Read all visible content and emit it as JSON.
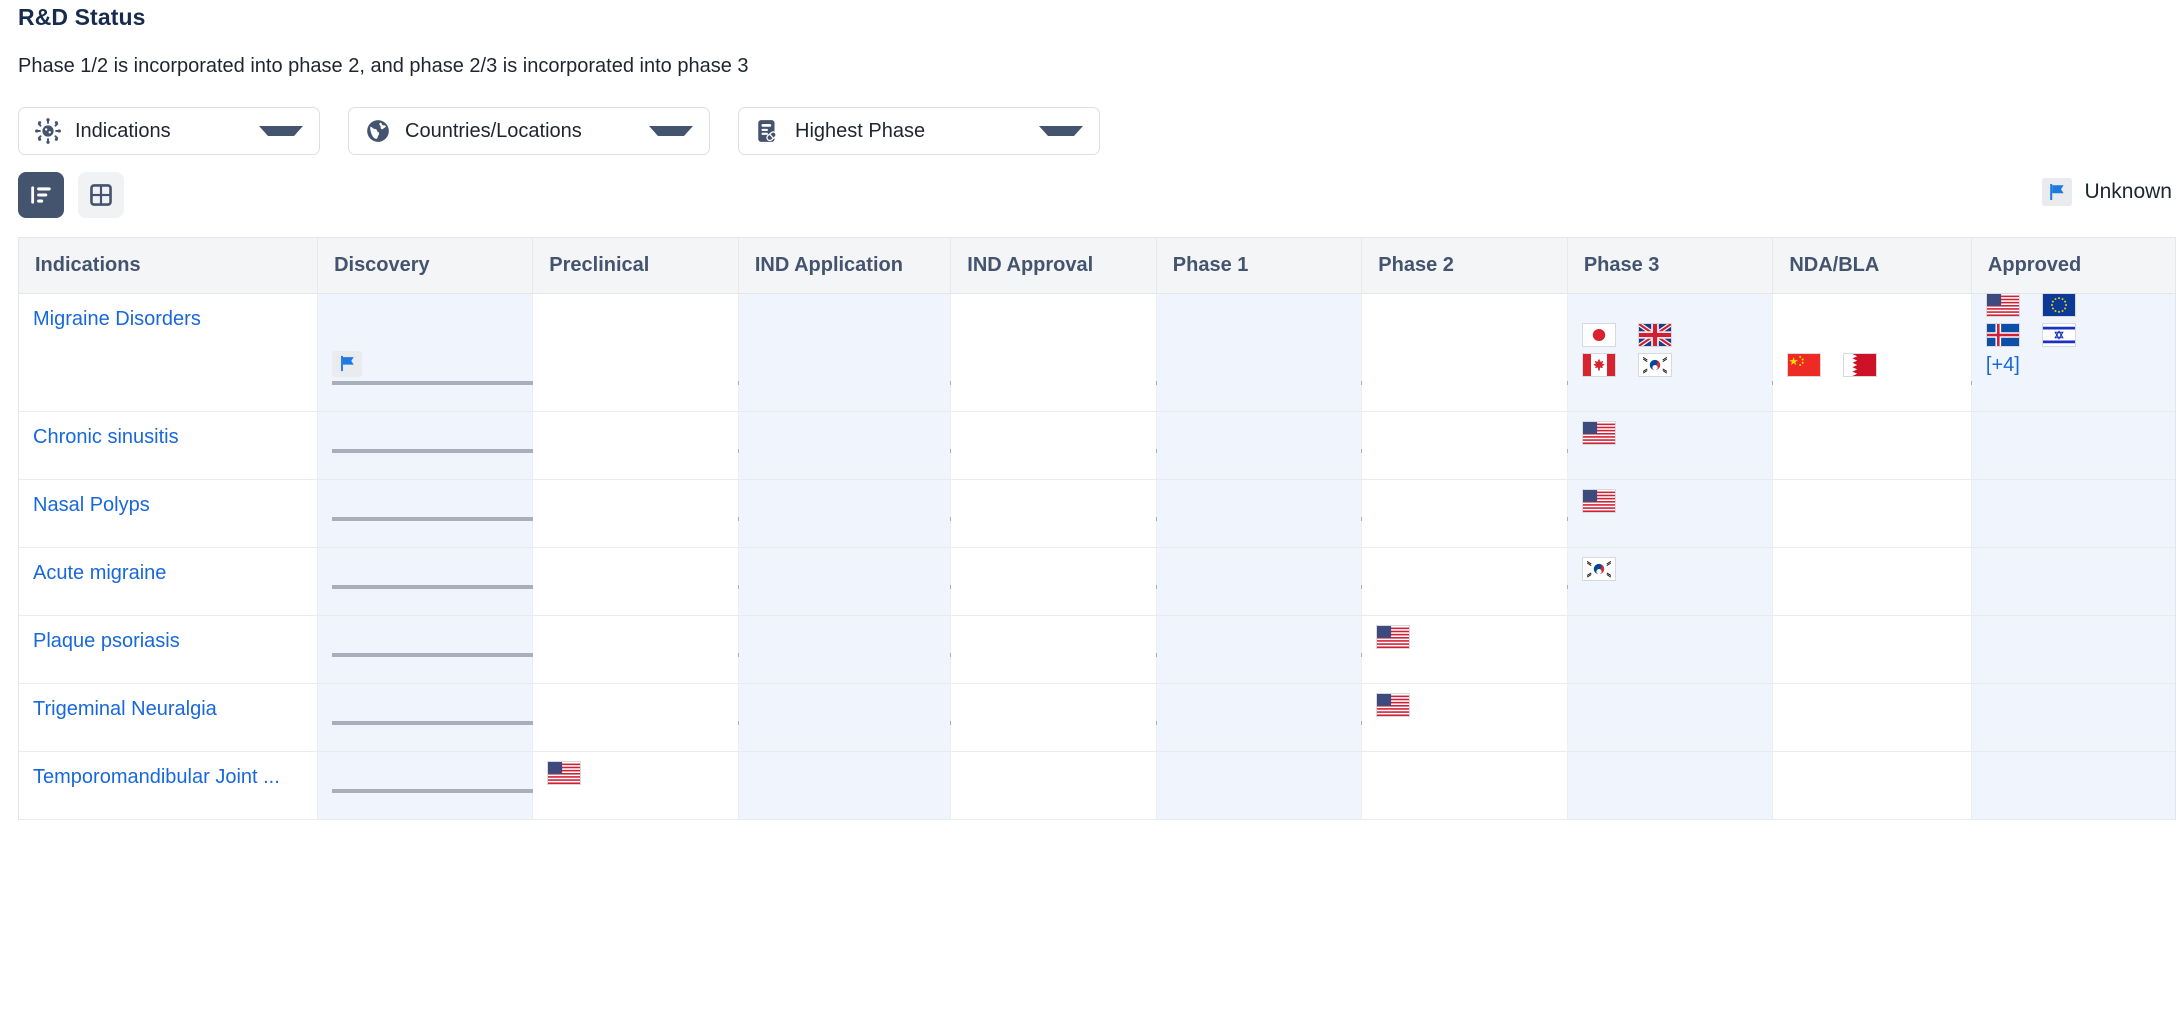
{
  "header": {
    "title": "R&D Status",
    "subtitle": "Phase 1/2 is incorporated into phase 2, and phase 2/3 is incorporated into phase 3"
  },
  "filters": [
    {
      "id": "indications",
      "label": "Indications",
      "icon": "virus-icon"
    },
    {
      "id": "countries",
      "label": "Countries/Locations",
      "icon": "globe-icon"
    },
    {
      "id": "phase",
      "label": "Highest Phase",
      "icon": "document-pill-icon"
    }
  ],
  "view_toggle": [
    {
      "id": "list-view",
      "icon": "list-view-icon",
      "active": true
    },
    {
      "id": "grid-view",
      "icon": "grid-view-icon",
      "active": false
    }
  ],
  "legend": {
    "icon": "flag-icon",
    "label": "Unknown"
  },
  "colors": {
    "link": "#1868db",
    "header_text": "#44546f",
    "header_bg": "#f4f5f7",
    "column_alt_bg": "#eff4fd",
    "arrow": "#a9aebb",
    "toggle_active_bg": "#44546f",
    "toggle_inactive_bg": "#f1f2f4",
    "flag_unknown_blue": "#1e7ae0"
  },
  "table": {
    "columns": [
      "Indications",
      "Discovery",
      "Preclinical",
      "IND Application",
      "IND Approval",
      "Phase 1",
      "Phase 2",
      "Phase 3",
      "NDA/BLA",
      "Approved"
    ],
    "rows": [
      {
        "indication": "Migraine Disorders",
        "arrow_from": "Discovery",
        "arrow_to": "Approved",
        "cells": {
          "Discovery": {
            "flags": [
              "unknown"
            ]
          },
          "Phase 3": {
            "flags": [
              "jp",
              "gb",
              "ca",
              "kr"
            ]
          },
          "NDA/BLA": {
            "flags": [
              "cn",
              "bh"
            ]
          },
          "Approved": {
            "flags": [
              "us",
              "eu",
              "is",
              "il"
            ],
            "more": "[+4]"
          }
        }
      },
      {
        "indication": "Chronic sinusitis",
        "arrow_from": "Discovery",
        "arrow_to": "Phase 3",
        "cells": {
          "Phase 3": {
            "flags": [
              "us"
            ]
          }
        }
      },
      {
        "indication": "Nasal Polyps",
        "arrow_from": "Discovery",
        "arrow_to": "Phase 3",
        "cells": {
          "Phase 3": {
            "flags": [
              "us"
            ]
          }
        }
      },
      {
        "indication": "Acute migraine",
        "arrow_from": "Discovery",
        "arrow_to": "Phase 3",
        "cells": {
          "Phase 3": {
            "flags": [
              "kr"
            ]
          }
        }
      },
      {
        "indication": "Plaque psoriasis",
        "arrow_from": "Discovery",
        "arrow_to": "Phase 2",
        "cells": {
          "Phase 2": {
            "flags": [
              "us"
            ]
          }
        }
      },
      {
        "indication": "Trigeminal Neuralgia",
        "arrow_from": "Discovery",
        "arrow_to": "Phase 2",
        "cells": {
          "Phase 2": {
            "flags": [
              "us"
            ]
          }
        }
      },
      {
        "indication": "Temporomandibular Joint ...",
        "arrow_from": "Discovery",
        "arrow_to": "Preclinical",
        "cells": {
          "Preclinical": {
            "flags": [
              "us"
            ]
          }
        }
      }
    ]
  }
}
